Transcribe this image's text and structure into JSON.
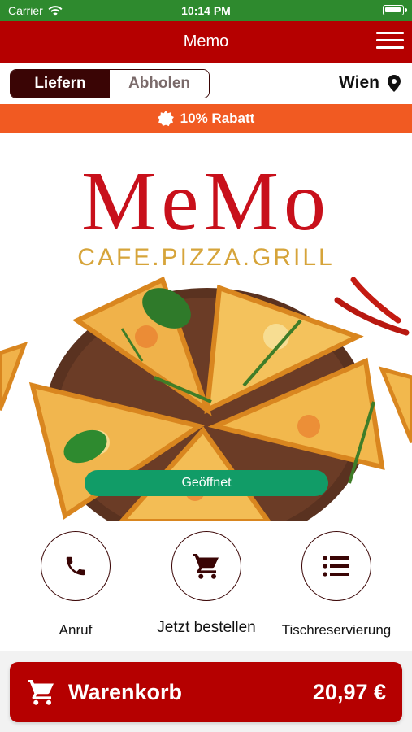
{
  "status_bar": {
    "carrier": "Carrier",
    "time": "10:14 PM"
  },
  "header": {
    "title": "Memo"
  },
  "order_mode": {
    "options": [
      "Liefern",
      "Abholen"
    ],
    "selected": "Liefern"
  },
  "location": {
    "city": "Wien"
  },
  "discount": {
    "text": "10% Rabatt"
  },
  "hero": {
    "logo": "MeMo",
    "logo_subtitle": "CAFE.PIZZA.GRILL",
    "status_button": "Geöffnet"
  },
  "actions": [
    {
      "label": "Anruf",
      "icon": "phone-icon"
    },
    {
      "label": "Jetzt bestellen",
      "icon": "cart-icon"
    },
    {
      "label": "Tischreservierung",
      "icon": "list-icon"
    }
  ],
  "cart": {
    "label": "Warenkorb",
    "total": "20,97 €"
  },
  "colors": {
    "brand_red": "#b50000",
    "discount_orange": "#f15a22",
    "open_green": "#119c67",
    "dark_maroon": "#3a0505"
  }
}
